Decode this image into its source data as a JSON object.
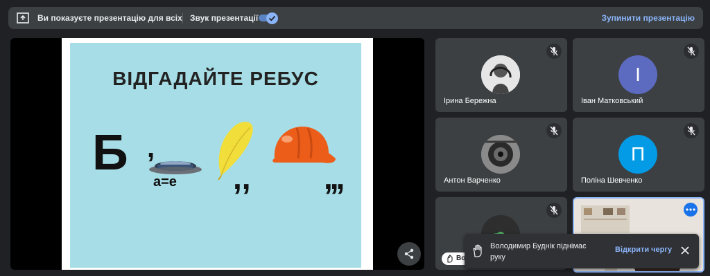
{
  "topbar": {
    "presenting_text": "Ви показуєте презентацію для всіх",
    "sound_label": "Звук презентації",
    "sound_on": true,
    "stop_label": "Зупинити презентацію"
  },
  "slide": {
    "title": "ВІДГАДАЙТЕ РЕБУС",
    "letter": "Б",
    "comma": ",",
    "substitution": "а=е",
    "commas_two": ",,",
    "commas_three": ",,,"
  },
  "participants": [
    {
      "name": "Ірина Бережна",
      "initial": "",
      "muted": true
    },
    {
      "name": "Іван Матковський",
      "initial": "І",
      "avatar_color": "#5c6bc0",
      "muted": true
    },
    {
      "name": "Антон Варченко",
      "initial": "",
      "muted": true
    },
    {
      "name": "Поліна Шевченко",
      "initial": "П",
      "avatar_color": "#039be5",
      "muted": true
    },
    {
      "name": "",
      "initial": "",
      "muted": true
    },
    {
      "name": "",
      "initial": "",
      "muted": false
    }
  ],
  "name_chip": "Во",
  "toast": {
    "message": "Володимир Буднік піднімає руку",
    "open_queue_label": "Відкрити чергу"
  },
  "colors": {
    "accent": "#8ab4f8",
    "slide_bg": "#a6dde6",
    "tile_bg": "#3c4043"
  }
}
